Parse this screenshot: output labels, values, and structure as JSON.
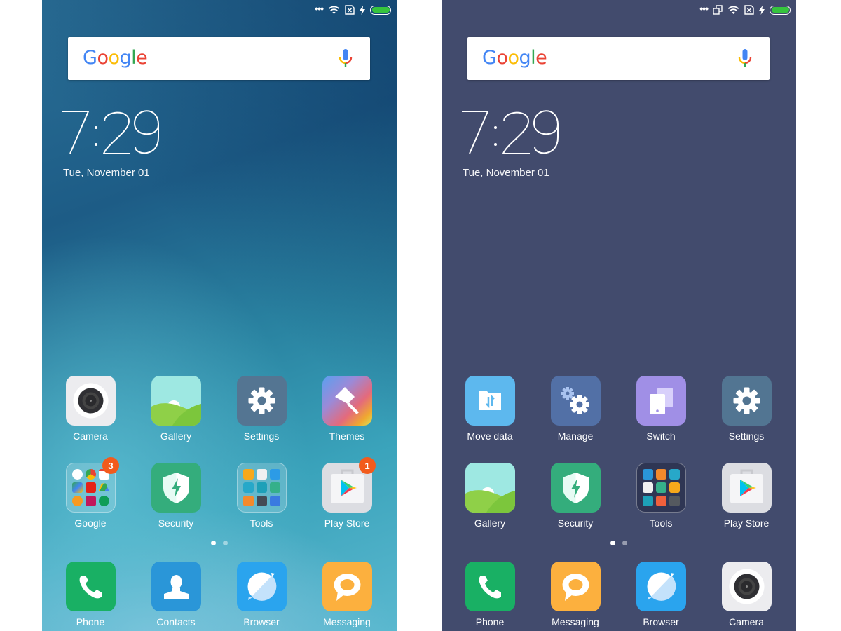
{
  "screens": [
    {
      "id": "left",
      "status_bar": {
        "icons": [
          "more-dots-icon",
          "wifi-icon",
          "no-sim-icon",
          "charging-bolt-icon",
          "battery-icon"
        ],
        "battery_percent": 100
      },
      "search": {
        "logo": "Google",
        "mic": "mic-icon"
      },
      "clock": {
        "time": "7:29",
        "date": "Tue, November 01"
      },
      "rows": [
        [
          {
            "label": "Camera",
            "icon": "camera-icon"
          },
          {
            "label": "Gallery",
            "icon": "gallery-icon"
          },
          {
            "label": "Settings",
            "icon": "settings-gear-icon"
          },
          {
            "label": "Themes",
            "icon": "themes-brush-icon"
          }
        ],
        [
          {
            "label": "Google",
            "icon": "google-folder-icon",
            "badge": "3"
          },
          {
            "label": "Security",
            "icon": "security-shield-icon"
          },
          {
            "label": "Tools",
            "icon": "tools-folder-icon"
          },
          {
            "label": "Play Store",
            "icon": "play-store-icon",
            "badge": "1"
          }
        ]
      ],
      "page_indicator": {
        "pages": 2,
        "current": 1
      },
      "dock": [
        {
          "label": "Phone",
          "icon": "phone-icon"
        },
        {
          "label": "Contacts",
          "icon": "contacts-icon"
        },
        {
          "label": "Browser",
          "icon": "browser-icon"
        },
        {
          "label": "Messaging",
          "icon": "messaging-icon"
        }
      ]
    },
    {
      "id": "right",
      "status_bar": {
        "icons": [
          "more-dots-icon",
          "screen-copy-icon",
          "wifi-icon",
          "no-sim-icon",
          "charging-bolt-icon",
          "battery-icon"
        ],
        "battery_percent": 100
      },
      "search": {
        "logo": "Google",
        "mic": "mic-icon"
      },
      "clock": {
        "time": "7:29",
        "date": "Tue, November 01"
      },
      "rows": [
        [
          {
            "label": "Move data",
            "icon": "move-data-icon"
          },
          {
            "label": "Manage",
            "icon": "manage-gears-icon"
          },
          {
            "label": "Switch",
            "icon": "switch-devices-icon"
          },
          {
            "label": "Settings",
            "icon": "settings-gear-icon"
          }
        ],
        [
          {
            "label": "Gallery",
            "icon": "gallery-icon"
          },
          {
            "label": "Security",
            "icon": "security-shield-icon"
          },
          {
            "label": "Tools",
            "icon": "tools-folder-icon"
          },
          {
            "label": "Play Store",
            "icon": "play-store-icon"
          }
        ]
      ],
      "page_indicator": {
        "pages": 2,
        "current": 1
      },
      "dock": [
        {
          "label": "Phone",
          "icon": "phone-icon"
        },
        {
          "label": "Messaging",
          "icon": "messaging-icon"
        },
        {
          "label": "Browser",
          "icon": "browser-icon"
        },
        {
          "label": "Camera",
          "icon": "camera-icon"
        }
      ]
    }
  ],
  "colors": {
    "left_wallpaper": "#2a7fa0",
    "right_wallpaper": "#424b6d",
    "badge": "#f25b1c",
    "battery_fill": "#36c43e",
    "google_blue": "#4285f4",
    "google_red": "#ea4335",
    "google_yellow": "#fbbc05",
    "google_green": "#34a853"
  }
}
